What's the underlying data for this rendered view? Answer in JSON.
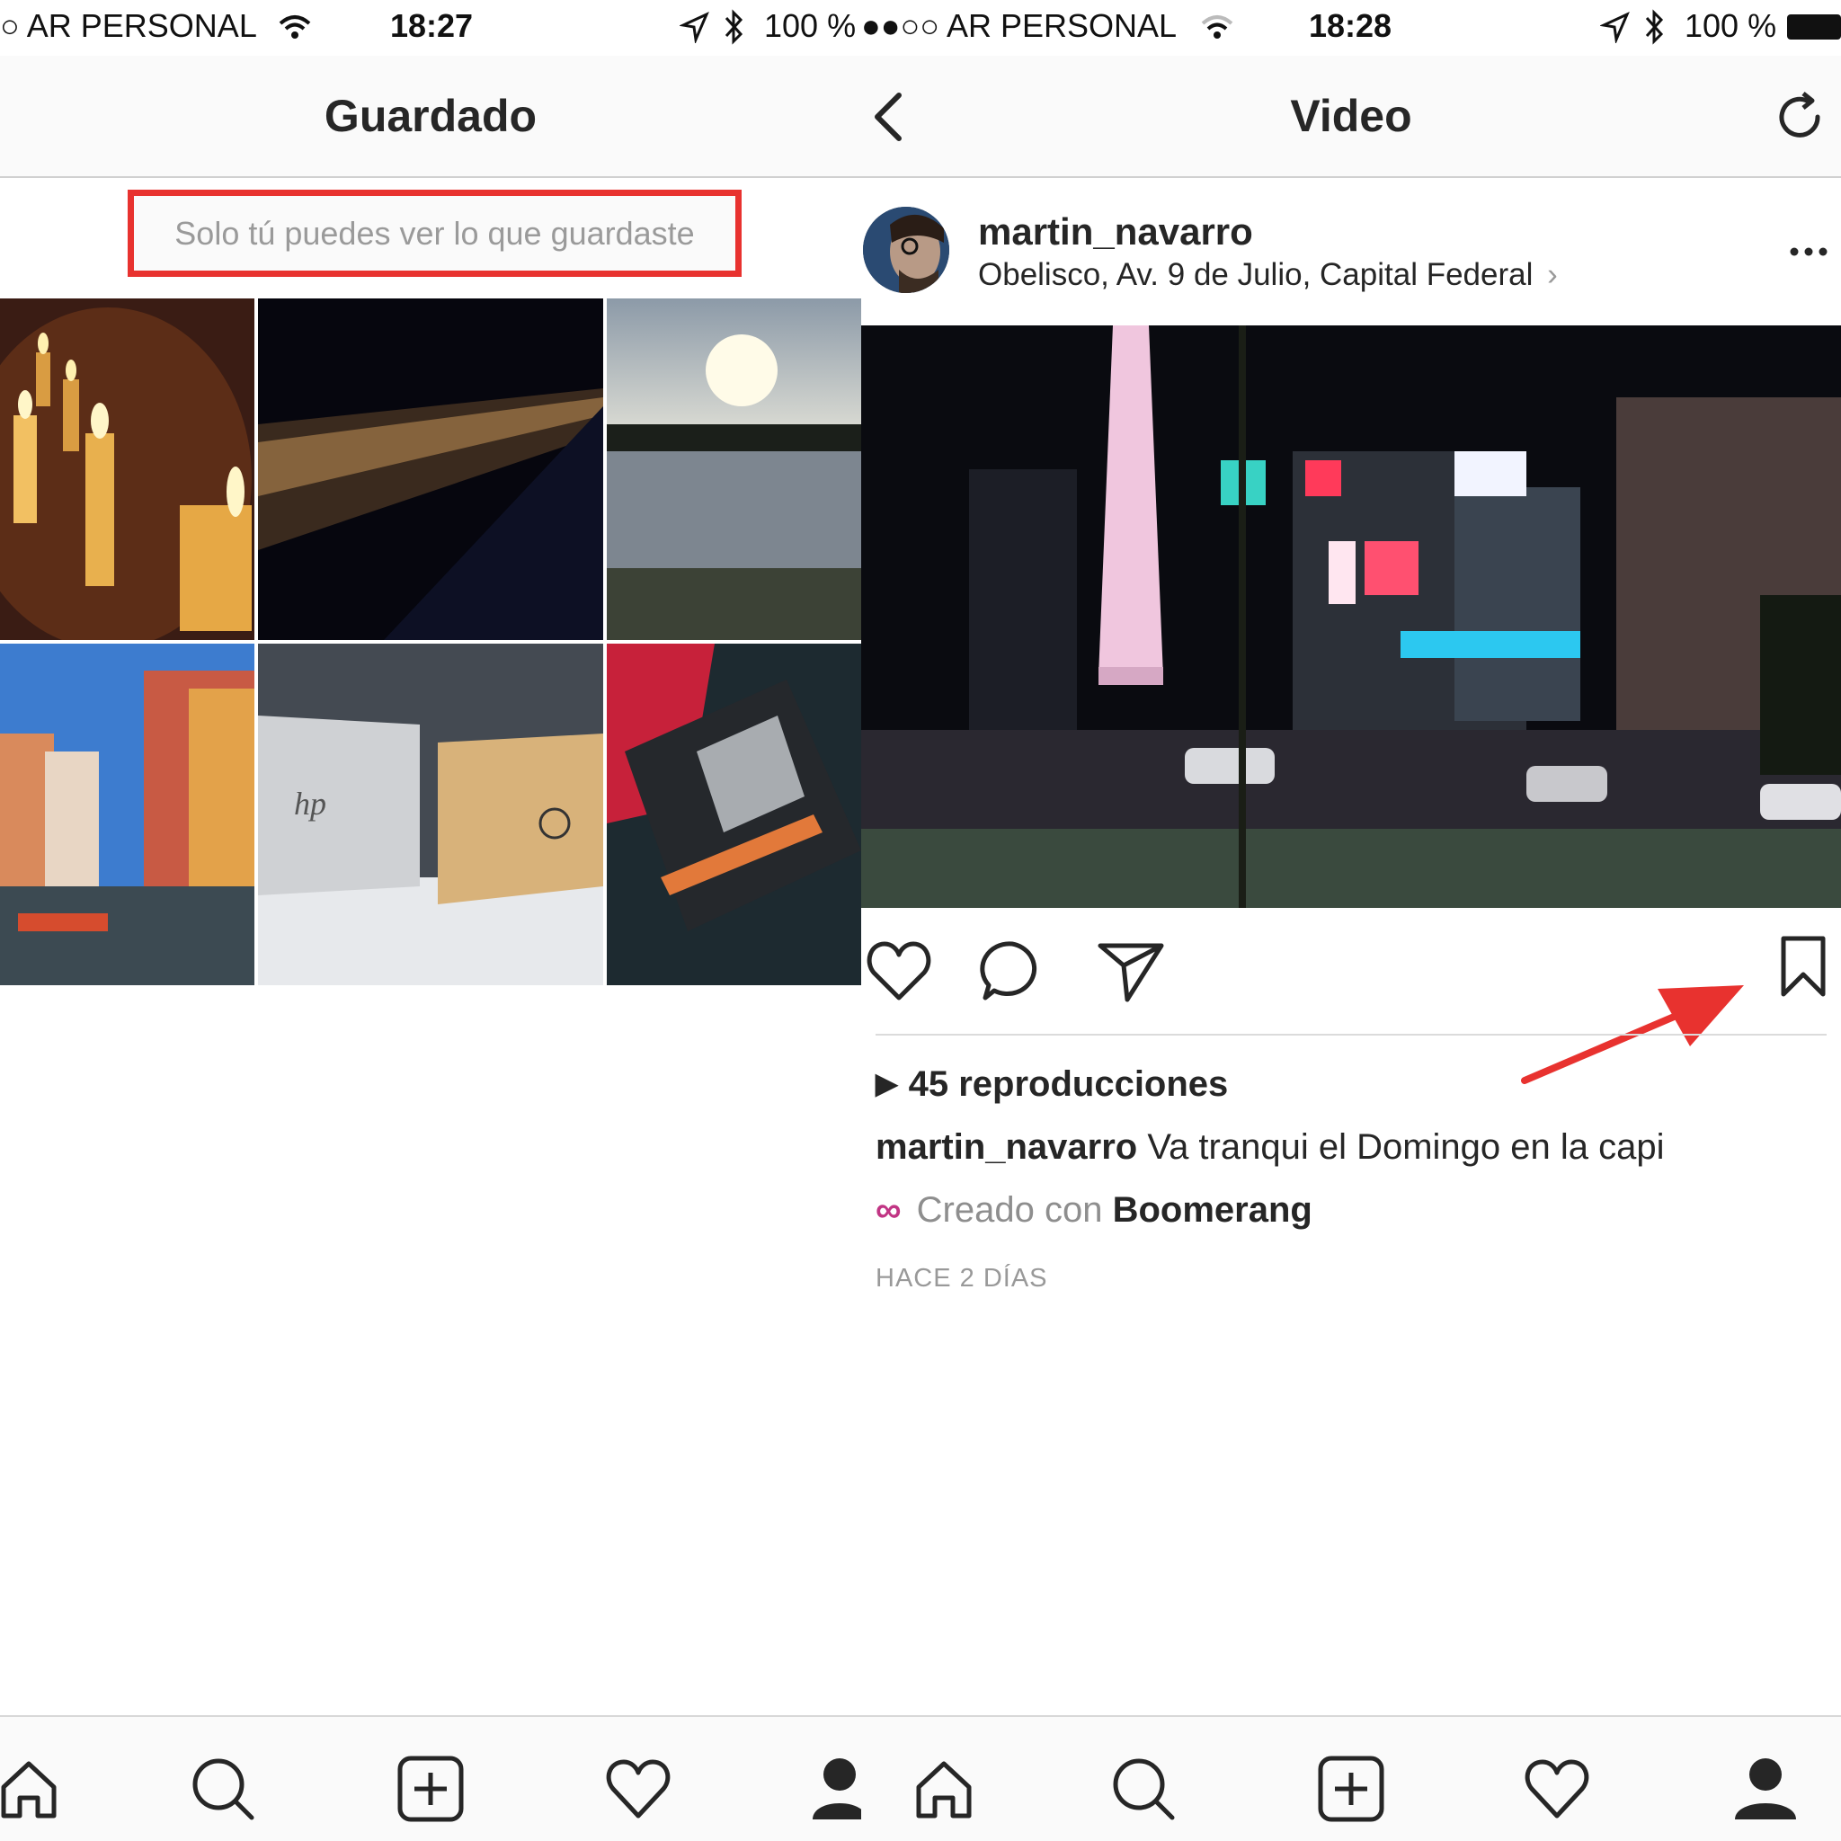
{
  "left": {
    "status": {
      "carrier": "○ AR PERSONAL",
      "time": "18:27",
      "battery": "100 %"
    },
    "title": "Guardado",
    "notice": "Solo tú puedes ver lo que guardaste",
    "grid": [
      {
        "name": "candles-photo"
      },
      {
        "name": "city-lights-photo"
      },
      {
        "name": "sunset-lake-photo"
      },
      {
        "name": "colorful-town-photo"
      },
      {
        "name": "laptops-photo"
      },
      {
        "name": "samsung-ssd-photo"
      }
    ],
    "tabbar": [
      "home-icon",
      "search-icon",
      "add-icon",
      "heart-icon",
      "profile-icon"
    ]
  },
  "right": {
    "status": {
      "carrier": "●●○○ AR PERSONAL",
      "time": "18:28",
      "battery": "100 %"
    },
    "title": "Video",
    "post": {
      "username": "martin_navarro",
      "location": "Obelisco, Av. 9 de Julio, Capital Federal",
      "views": "45 reproducciones",
      "caption_user": "martin_navarro",
      "caption_text": "Va tranqui el Domingo en la capi",
      "created_prefix": "Creado con",
      "created_app": "Boomerang",
      "time_ago": "HACE 2 DÍAS"
    },
    "tabbar": [
      "home-icon",
      "search-icon",
      "add-icon",
      "heart-icon",
      "profile-icon"
    ]
  },
  "colors": {
    "highlight": "#e8322f",
    "boomerang": "#c13584"
  }
}
